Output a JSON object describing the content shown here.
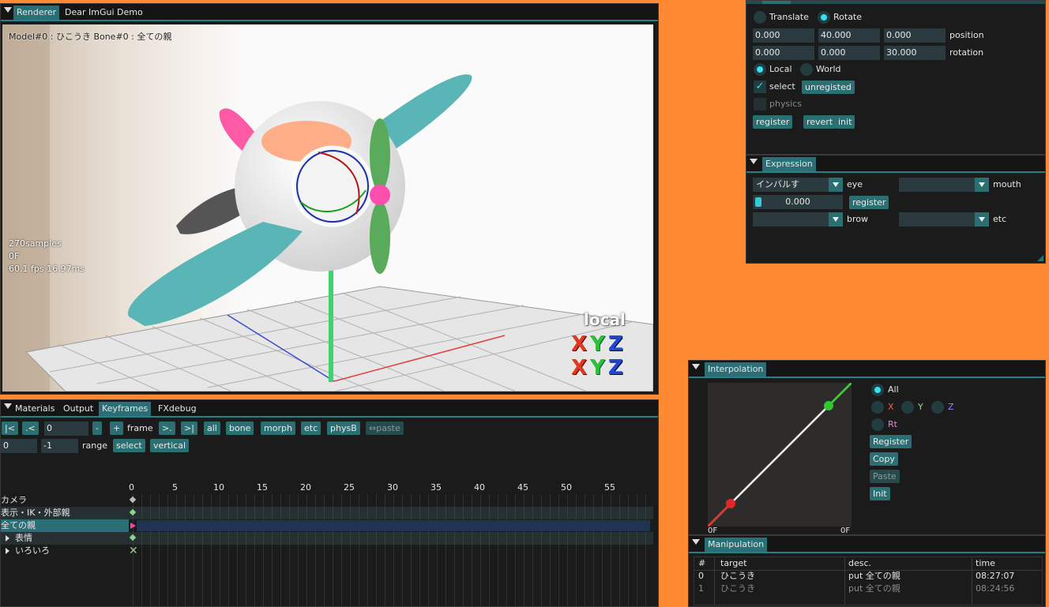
{
  "renderer": {
    "tabs": [
      "Renderer",
      "Dear ImGui Demo"
    ],
    "overlay_top": "Model#0 : ひこうき Bone#0 : 全ての親",
    "overlay_stats": [
      "270samples",
      "0F",
      "60.1 fps 16.97ms"
    ],
    "gizmo_label": "local",
    "axis_letters": [
      "X",
      "Y",
      "Z"
    ]
  },
  "transform": {
    "translate_label": "Translate",
    "rotate_label": "Rotate",
    "position_values": [
      "0.000",
      "40.000",
      "0.000"
    ],
    "position_label": "position",
    "rotation_values": [
      "0.000",
      "0.000",
      "30.000"
    ],
    "rotation_label": "rotation",
    "local_label": "Local",
    "world_label": "World",
    "select_label": "select",
    "unregisted_label": "unregisted",
    "physics_label": "physics",
    "register_label": "register",
    "revert_label": "revert",
    "init_label": "init"
  },
  "expression": {
    "tab": "Expression",
    "eye_value": "インバルす",
    "eye_label": "eye",
    "mouth_label": "mouth",
    "weight_value": "0.000",
    "register_label": "register",
    "brow_label": "brow",
    "etc_label": "etc"
  },
  "keyframes": {
    "tabs": [
      "Materials",
      "Output",
      "Keyframes",
      "FXdebug"
    ],
    "nav": {
      "first": "|<",
      "prev": ".<",
      "frame_value": "0",
      "minus": "-",
      "plus": "+",
      "frame_label": "frame",
      "next": ">.",
      "last": ">|"
    },
    "filters": [
      "all",
      "bone",
      "morph",
      "etc",
      "physB"
    ],
    "paste_label": "⇔paste",
    "range_start": "0",
    "range_end": "-1",
    "range_label": "range",
    "select_label": "select",
    "vertical_label": "vertical",
    "ticks": [
      "0",
      "5",
      "10",
      "15",
      "20",
      "25",
      "30",
      "35",
      "40",
      "45",
      "50",
      "55"
    ],
    "tracks": [
      "カメラ",
      "表示・IK・外部親",
      "全ての親",
      "表情",
      "いろいろ"
    ]
  },
  "interpolation": {
    "tab": "Interpolation",
    "all_label": "All",
    "x_label": "X",
    "y_label": "Y",
    "z_label": "Z",
    "rt_label": "Rt",
    "register_label": "Register",
    "copy_label": "Copy",
    "paste_label": "Paste",
    "init_label": "Init",
    "axis_left": "0F",
    "axis_right": "0F"
  },
  "manipulation": {
    "tab": "Manipulation",
    "headers": [
      "#",
      "target",
      "desc.",
      "time"
    ],
    "rows": [
      {
        "idx": "0",
        "target": "ひこうき",
        "desc": "put 全ての親",
        "time": "08:27:07"
      },
      {
        "idx": "1",
        "target": "ひこうき",
        "desc": "put 全ての親",
        "time": "08:24:56"
      }
    ]
  },
  "colors": {
    "accent": "#2a6f75",
    "background": "#ff8a33",
    "axis_x": "#e03a1e",
    "axis_y": "#2fbf3a",
    "axis_z": "#2246d8"
  }
}
